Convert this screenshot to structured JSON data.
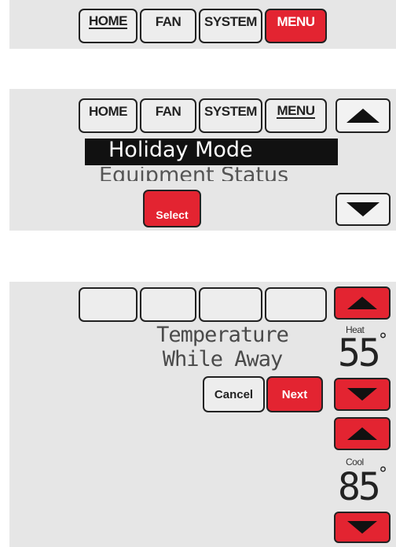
{
  "screen1": {
    "tabs": {
      "home": "HOME",
      "fan": "FAN",
      "system": "SYSTEM",
      "menu": "MENU"
    },
    "active_tab": "MENU"
  },
  "screen2": {
    "tabs": {
      "home": "HOME",
      "fan": "FAN",
      "system": "SYSTEM",
      "menu": "MENU"
    },
    "menu_items": [
      "Holiday Mode",
      "Equipment Status"
    ],
    "selected_item": "Holiday Mode",
    "select_label": "Select",
    "up_icon": "up-arrow-icon",
    "down_icon": "down-arrow-icon"
  },
  "screen3": {
    "prompt_line1": "Temperature",
    "prompt_line2": "While Away",
    "cancel_label": "Cancel",
    "next_label": "Next",
    "heat_label": "Heat",
    "heat_value": "55",
    "cool_label": "Cool",
    "cool_value": "85",
    "degree_symbol": "°"
  },
  "colors": {
    "accent_red": "#e32431",
    "panel_bg": "#e6e6e6",
    "outline": "#222222"
  }
}
